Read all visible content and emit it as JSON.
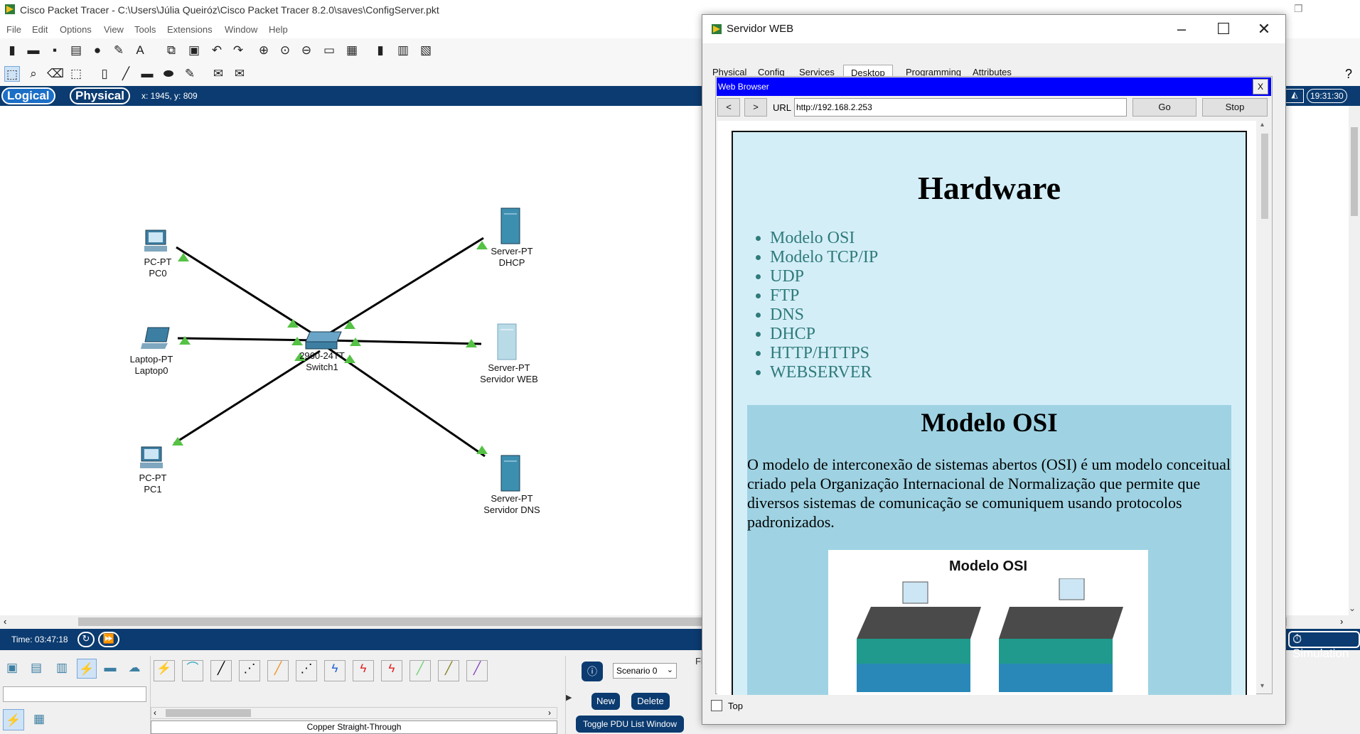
{
  "window": {
    "title": "Cisco Packet Tracer - C:\\Users\\Júlia Queiróz\\Cisco Packet Tracer 8.2.0\\saves\\ConfigServer.pkt"
  },
  "menu": [
    "File",
    "Edit",
    "Options",
    "View",
    "Tools",
    "Extensions",
    "Window",
    "Help"
  ],
  "logical_bar": {
    "logical": "Logical",
    "physical": "Physical",
    "coords": "x: 1945, y: 809",
    "clock": "19:31:30"
  },
  "devices": [
    {
      "type": "PC-PT",
      "name": "PC0"
    },
    {
      "type": "Laptop-PT",
      "name": "Laptop0"
    },
    {
      "type": "PC-PT",
      "name": "PC1"
    },
    {
      "type": "2960-24TT",
      "name": "Switch1"
    },
    {
      "type": "Server-PT",
      "name": "DHCP"
    },
    {
      "type": "Server-PT",
      "name": "Servidor WEB"
    },
    {
      "type": "Server-PT",
      "name": "Servidor DNS"
    }
  ],
  "bottom": {
    "time": "Time: 03:47:18",
    "cable_name": "Copper Straight-Through",
    "scenario": "Scenario 0",
    "new": "New",
    "delete": "Delete",
    "toggle_pdu": "Toggle PDU List Window",
    "simulation": "Simulation",
    "fire_label": "Fi"
  },
  "dialog": {
    "title": "Servidor WEB",
    "tabs": [
      "Physical",
      "Config",
      "Services",
      "Desktop",
      "Programming",
      "Attributes"
    ],
    "active_tab": "Desktop",
    "browser_title": "Web Browser",
    "close_x": "X",
    "back": "<",
    "forward": ">",
    "url_label": "URL",
    "url": "http://192.168.2.253",
    "go": "Go",
    "stop": "Stop",
    "top_checkbox": "Top",
    "page": {
      "heading": "Hardware",
      "links": [
        "Modelo OSI",
        "Modelo TCP/IP",
        "UDP",
        "FTP",
        "DNS",
        "DHCP",
        "HTTP/HTTPS",
        "WEBSERVER"
      ],
      "section_title": "Modelo OSI",
      "section_text": "O modelo de interconexão de sistemas abertos (OSI) é um modelo conceitual criado pela Organização Internacional de Normalização que permite que diversos sistemas de comunicação se comuniquem usando protocolos padronizados.",
      "image_title": "Modelo OSI"
    }
  },
  "colors": {
    "accent": "#0b3b70",
    "browser_bar": "#0000ff",
    "link": "#2f7b7a",
    "page_bg": "#d4eef8",
    "section_bg": "#9fd3e3"
  }
}
